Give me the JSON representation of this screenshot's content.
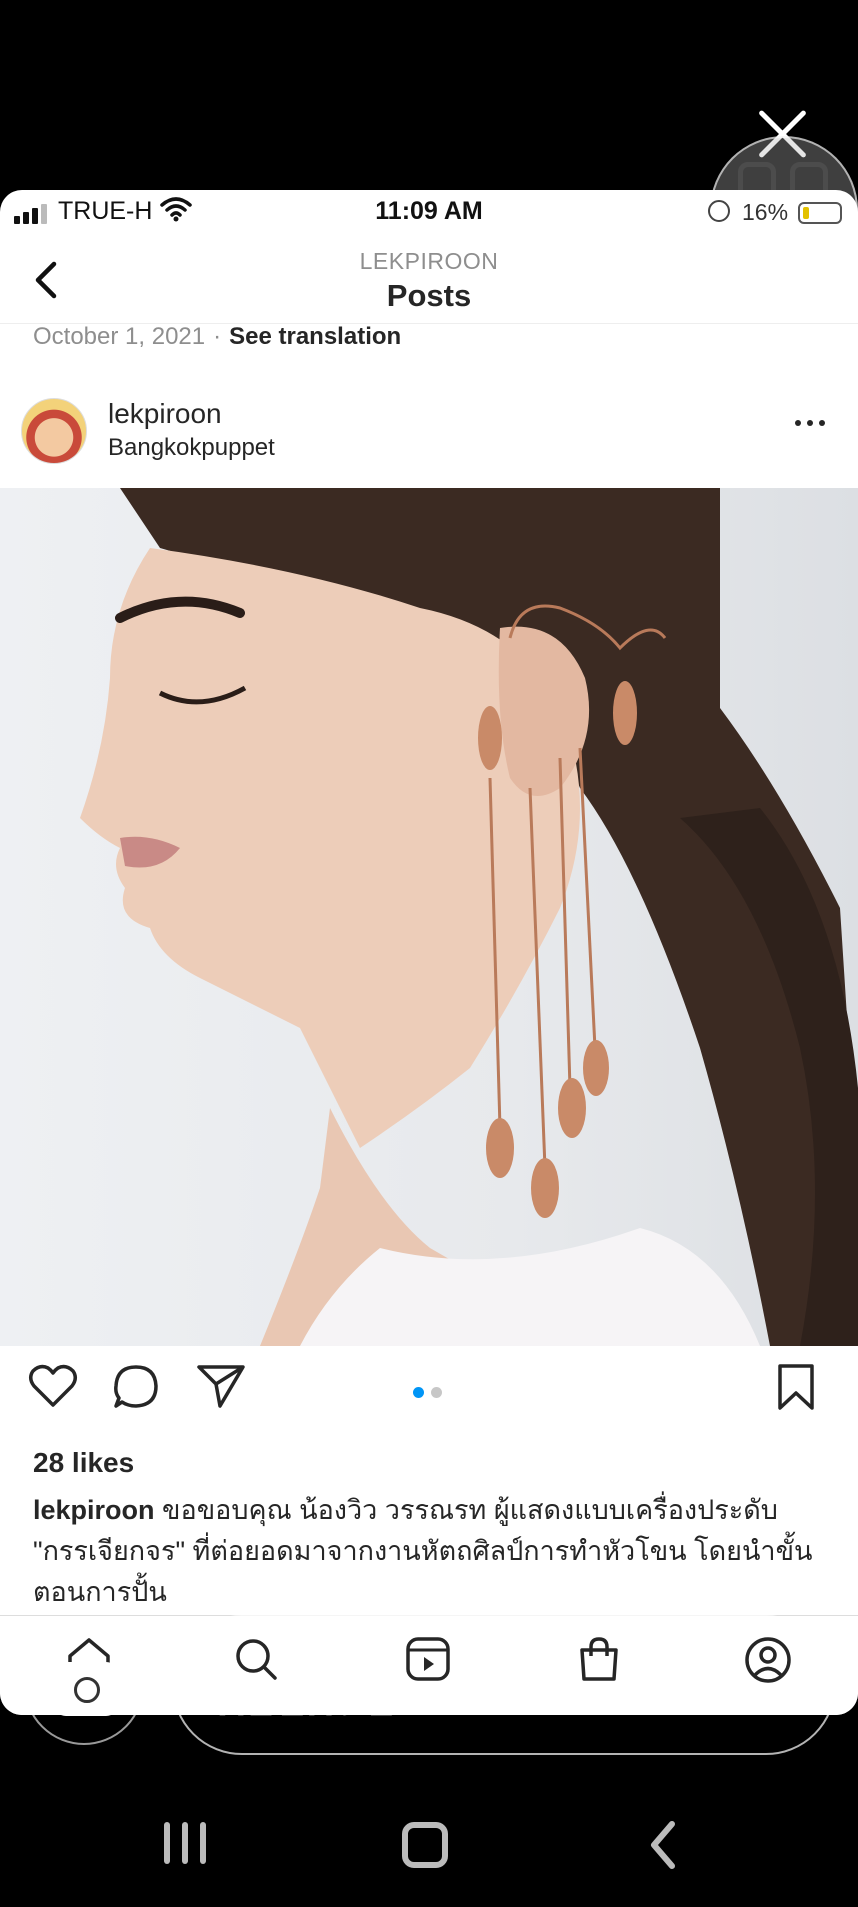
{
  "status_bar": {
    "carrier": "TRUE-H",
    "time": "11:09 AM",
    "battery_percent": "16%"
  },
  "header": {
    "username": "LEKPIROON",
    "title": "Posts"
  },
  "post": {
    "date": "October 1, 2021",
    "see_translation": "See translation",
    "author": "lekpiroon",
    "location": "Bangkokpuppet",
    "likes": "28 likes",
    "caption_user": "lekpiroon",
    "caption_text": "ขอขอบคุณ น้องวิว วรรณรท ผู้แสดงแบบเครื่องประดับ \"กรรเจียกจร\" ที่ต่อยอดมาจากงานหัตถศิลป์การทำหัวโขน โดยนำขั้นตอนการปั้น",
    "carousel_index": 1,
    "carousel_count": 2
  },
  "reply": {
    "placeholder": "ตอบกลับ..."
  },
  "colors": {
    "accent": "#0095f6",
    "inactive_dot": "#c7c7c7",
    "text": "#262626",
    "muted": "#8e8e8e"
  },
  "icons": {
    "action_row": [
      "heart-icon",
      "comment-icon",
      "share-icon",
      "bookmark-icon"
    ],
    "tab_bar": [
      "home-icon",
      "search-icon",
      "reels-icon",
      "shop-icon",
      "profile-icon"
    ]
  }
}
